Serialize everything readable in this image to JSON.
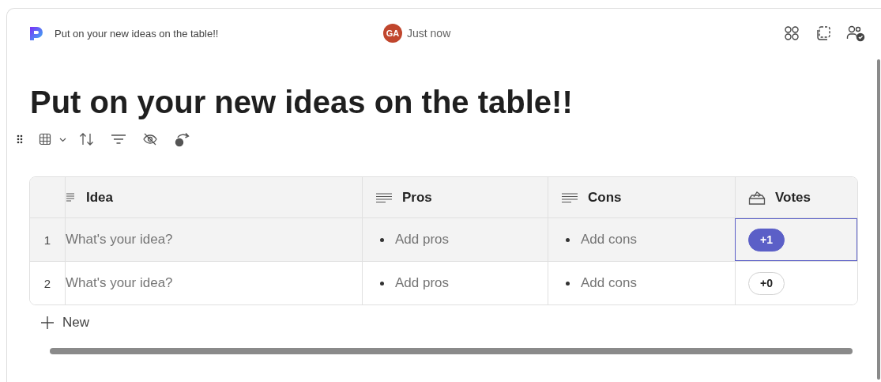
{
  "header": {
    "doc_name": "Put on your new ideas on the table!!",
    "avatar": "GA",
    "timestamp": "Just now"
  },
  "title": "Put on your new ideas on the table!!",
  "table": {
    "columns": [
      {
        "label": "Idea",
        "kind": "title"
      },
      {
        "label": "Pros",
        "kind": "text"
      },
      {
        "label": "Cons",
        "kind": "text"
      },
      {
        "label": "Votes",
        "kind": "vote"
      }
    ],
    "rows": [
      {
        "number": "1",
        "selected": true,
        "idea": {
          "placeholder": "What's your idea?"
        },
        "pros": "Add pros",
        "cons": "Add cons",
        "votes": {
          "label": "+1",
          "voted": true
        }
      },
      {
        "number": "2",
        "selected": false,
        "idea": {
          "placeholder": "What's your idea?"
        },
        "pros": "Add pros",
        "cons": "Add cons",
        "votes": {
          "label": "+0",
          "voted": false
        }
      }
    ]
  },
  "new_row": "New"
}
